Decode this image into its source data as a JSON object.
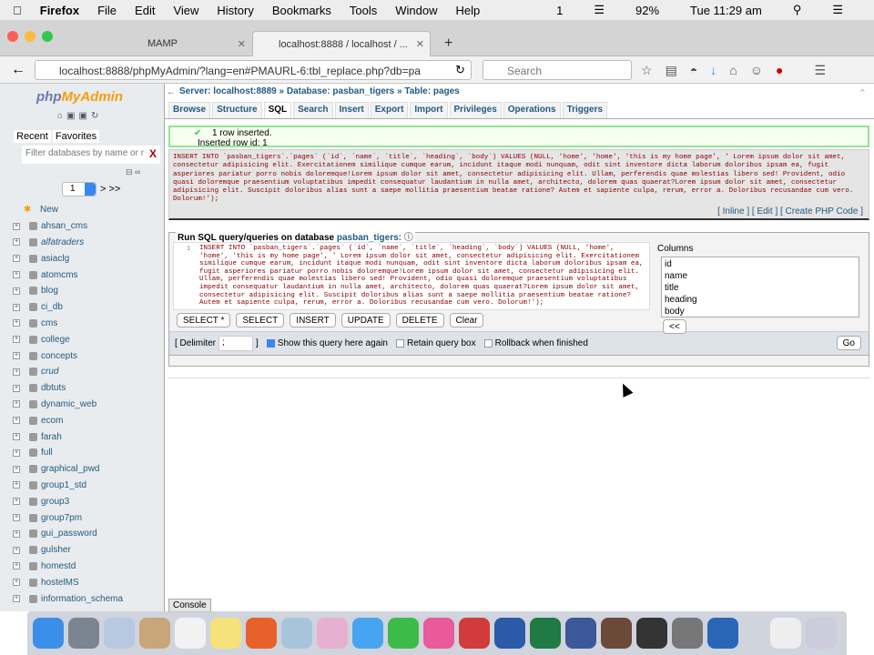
{
  "menubar": {
    "app": "Firefox",
    "items": [
      "File",
      "Edit",
      "View",
      "History",
      "Bookmarks",
      "Tools",
      "Window",
      "Help"
    ],
    "battery": "92%",
    "clock": "Tue 11:29 am",
    "badge": "1"
  },
  "browser": {
    "tabs": [
      {
        "label": "MAMP"
      },
      {
        "label": "localhost:8888 / localhost / ..."
      }
    ],
    "url": "localhost:8888/phpMyAdmin/?lang=en#PMAURL-6:tbl_replace.php?db=pa",
    "search_placeholder": "Search"
  },
  "sidebar": {
    "logo_php": "php",
    "logo_my": "MyAdmin",
    "tabs": [
      "Recent",
      "Favorites"
    ],
    "filter_placeholder": "Filter databases by name or r",
    "filter_clear": "X",
    "page": "1",
    "page_next": "> >>",
    "databases": [
      {
        "name": "New"
      },
      {
        "name": "ahsan_cms"
      },
      {
        "name": "alfatraders",
        "italic": true
      },
      {
        "name": "asiaclg"
      },
      {
        "name": "atomcms"
      },
      {
        "name": "blog"
      },
      {
        "name": "ci_db"
      },
      {
        "name": "cms"
      },
      {
        "name": "college"
      },
      {
        "name": "concepts"
      },
      {
        "name": "crud",
        "italic": true
      },
      {
        "name": "dbtuts"
      },
      {
        "name": "dynamic_web"
      },
      {
        "name": "ecom"
      },
      {
        "name": "farah"
      },
      {
        "name": "full"
      },
      {
        "name": "graphical_pwd"
      },
      {
        "name": "group1_std"
      },
      {
        "name": "group3"
      },
      {
        "name": "group7pm"
      },
      {
        "name": "gui_password"
      },
      {
        "name": "gulsher"
      },
      {
        "name": "homestd"
      },
      {
        "name": "hostelMS"
      },
      {
        "name": "information_schema"
      }
    ]
  },
  "breadcrumb": {
    "server": "Server: localhost:8889",
    "database": "Database: pasban_tigers",
    "table": "Table: pages"
  },
  "tabs": [
    "Browse",
    "Structure",
    "SQL",
    "Search",
    "Insert",
    "Export",
    "Import",
    "Privileges",
    "Operations",
    "Triggers"
  ],
  "message": {
    "line1": "1 row inserted.",
    "line2": "Inserted row id: 1"
  },
  "executed_sql": "INSERT INTO `pasban_tigers`.`pages` (`id`, `name`, `title`, `heading`, `body`) VALUES (NULL, 'home', 'home', 'this is my home page', ' Lorem ipsum dolor sit amet, consectetur adipisicing elit. Exercitationem similique cumque earum, incidunt itaque modi nunquam, odit sint inventore dicta laborum doloribus ipsam ea, fugit asperiores pariatur porro nobis doloremque!Lorem ipsum dolor sit amet, consectetur adipisicing elit. Ullam, perferendis quae molestias libero sed! Provident, odio quasi doloremque praesentium voluptatibus impedit consequatur laudantium in nulla amet, architecto, dolorem quas quaerat?Lorem ipsum dolor sit amet, consectetur adipisicing elit. Suscipit doloribus alias sunt a saepe mollitia praesentium beatae ratione? Autem et sapiente culpa, rerum, error a. Doloribus recusandae cum vero. Dolorum!');",
  "sql_links": "[ Inline ] [ Edit ] [ Create PHP Code ]",
  "query_panel": {
    "legend": "Run SQL query/queries on database ",
    "db": "pasban_tigers:",
    "line_no": "1",
    "buttons": [
      "SELECT *",
      "SELECT",
      "INSERT",
      "UPDATE",
      "DELETE",
      "Clear"
    ],
    "columns_label": "Columns",
    "columns": [
      "id",
      "name",
      "title",
      "heading",
      "body"
    ],
    "insert_col": "<<"
  },
  "options": {
    "delimiter_label": "[ Delimiter",
    "delimiter_value": ";",
    "close_bracket": "]",
    "show_again": "Show this query here again",
    "show_again_checked": true,
    "retain": "Retain query box",
    "rollback": "Rollback when finished",
    "go": "Go"
  },
  "console": "Console"
}
